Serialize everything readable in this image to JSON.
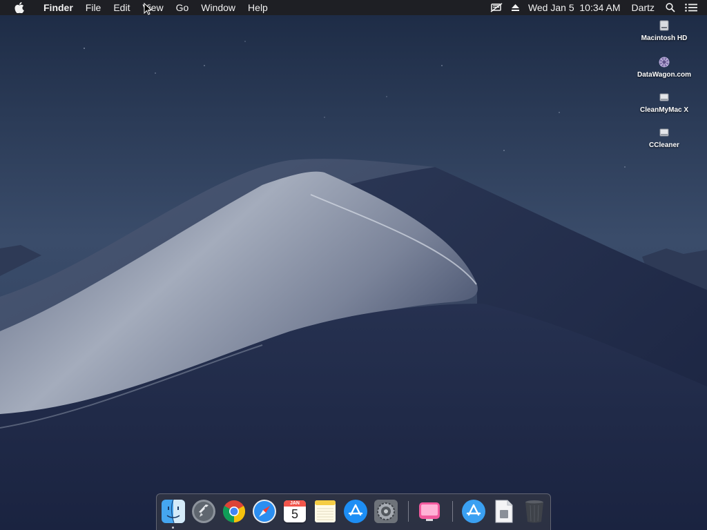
{
  "menubar": {
    "app_name": "Finder",
    "menus": [
      "File",
      "Edit",
      "View",
      "Go",
      "Window",
      "Help"
    ],
    "status": {
      "datetime": "Wed Jan 5  10:34 AM",
      "user": "Dartz"
    }
  },
  "desktop_icons": [
    {
      "label": "Macintosh HD",
      "icon": "hard-drive-icon"
    },
    {
      "label": "DataWagon.com",
      "icon": "network-volume-icon"
    },
    {
      "label": "CleanMyMac X",
      "icon": "disk-image-icon"
    },
    {
      "label": "CCleaner",
      "icon": "disk-image-icon"
    }
  ],
  "dock": {
    "items": [
      {
        "name": "Finder",
        "icon": "finder-icon"
      },
      {
        "name": "Launchpad",
        "icon": "launchpad-icon"
      },
      {
        "name": "Google Chrome",
        "icon": "chrome-icon"
      },
      {
        "name": "Safari",
        "icon": "safari-icon"
      },
      {
        "name": "Calendar",
        "icon": "calendar-icon",
        "month": "JAN",
        "day": "5"
      },
      {
        "name": "Notes",
        "icon": "notes-icon"
      },
      {
        "name": "App Store",
        "icon": "app-store-icon"
      },
      {
        "name": "System Preferences",
        "icon": "system-preferences-icon"
      },
      {
        "name": "CleanMyMac X",
        "icon": "cleanmymac-icon"
      },
      {
        "name": "Applications",
        "icon": "applications-folder-icon"
      },
      {
        "name": "Documents",
        "icon": "document-stack-icon"
      },
      {
        "name": "Trash",
        "icon": "trash-icon"
      }
    ]
  },
  "colors": {
    "menubar_bg": "#1e1e22",
    "sky_top": "#1c2a44",
    "dune_light": "#9aa3b4",
    "dune_dark": "#1b2440"
  }
}
